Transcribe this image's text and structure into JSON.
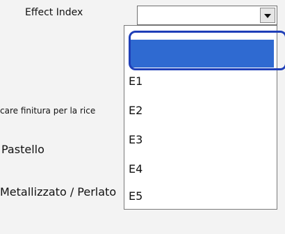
{
  "form": {
    "effect_index_label": "Effect Index",
    "select_value": ""
  },
  "background": {
    "finish_text": "care finitura per la rice",
    "option_pastel": "Pastello",
    "option_metal": "Metallizzato / Perlato"
  },
  "dropdown": {
    "options": [
      "",
      "E1",
      "E2",
      "E3",
      "E4",
      "E5"
    ],
    "selected_index": 0,
    "selected_color": "#2f6ad1"
  }
}
